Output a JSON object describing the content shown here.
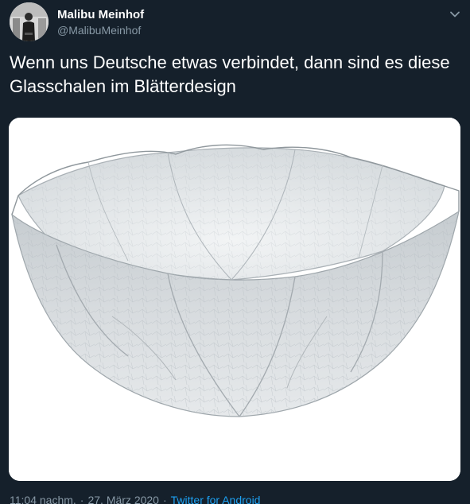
{
  "author": {
    "display_name": "Malibu Meinhof",
    "handle": "@MalibuMeinhof"
  },
  "tweet": {
    "text": "Wenn uns Deutsche etwas verbindet, dann sind es diese Glasschalen im Blätterdesign"
  },
  "meta": {
    "time": "11:04 nachm.",
    "separator": "·",
    "date": "27. März 2020",
    "source": "Twitter for Android"
  },
  "icons": {
    "menu": "chevron-down-icon"
  },
  "colors": {
    "background": "#15202b",
    "text_primary": "#ffffff",
    "text_secondary": "#8899a6",
    "link": "#1da1f2"
  }
}
